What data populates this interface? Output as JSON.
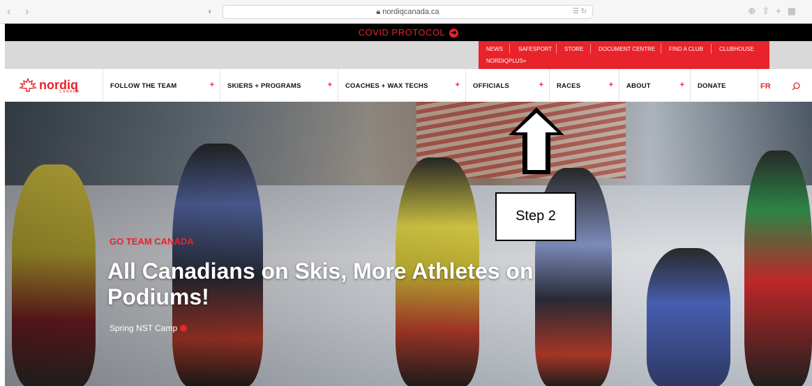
{
  "browser": {
    "url": "nordiqcanada.ca",
    "back_icon": "chevron-left-icon",
    "forward_icon": "chevron-right-icon"
  },
  "covid_bar": {
    "label": "COVID PROTOCOL"
  },
  "utility_links": [
    "NEWS",
    "SAFESPORT",
    "STORE",
    "DOCUMENT CENTRE",
    "FIND A CLUB",
    "CLUBHOUSE",
    "NORDIQPLUS+"
  ],
  "logo": {
    "word": "nordiq",
    "sub": "CANADA"
  },
  "nav": {
    "items": [
      {
        "label": "FOLLOW THE TEAM"
      },
      {
        "label": "SKIERS + PROGRAMS"
      },
      {
        "label": "COACHES + WAX TECHS"
      },
      {
        "label": "OFFICIALS"
      },
      {
        "label": "RACES"
      },
      {
        "label": "ABOUT"
      },
      {
        "label": "DONATE"
      }
    ],
    "plus": "+",
    "lang": "FR"
  },
  "hero": {
    "kicker": "GO TEAM CANADA",
    "headline": "All Canadians on Skis, More Athletes on Podiums!",
    "caption": "Spring NST Camp"
  },
  "annotation": {
    "label": "Step 2"
  },
  "colors": {
    "brand_red": "#e8232b",
    "black": "#000000",
    "util_gray": "#d9d9d9"
  }
}
